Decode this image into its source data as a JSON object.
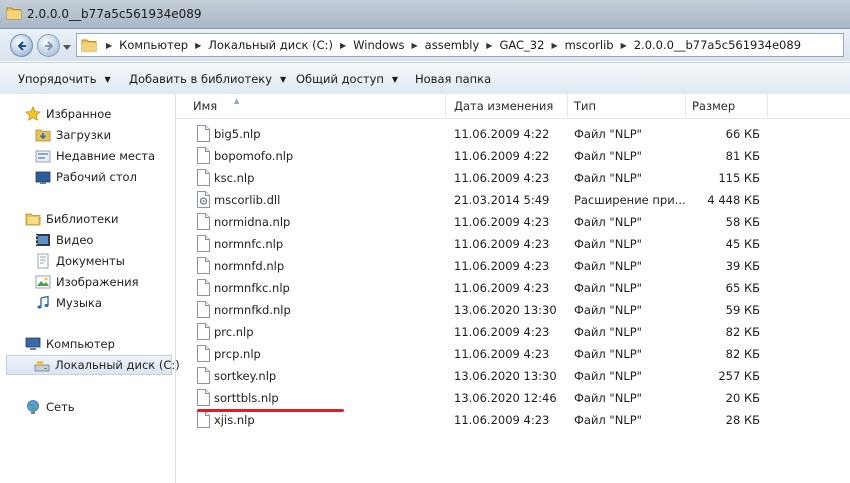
{
  "window": {
    "title": "2.0.0.0__b77a5c561934e089"
  },
  "address": {
    "crumbs": [
      "Компьютер",
      "Локальный диск (C:)",
      "Windows",
      "assembly",
      "GAC_32",
      "mscorlib",
      "2.0.0.0__b77a5c561934e089"
    ]
  },
  "toolbar": {
    "organize": "Упорядочить",
    "add_library": "Добавить в библиотеку",
    "share": "Общий доступ",
    "new_folder": "Новая папка"
  },
  "nav": {
    "favorites": "Избранное",
    "downloads": "Загрузки",
    "recent": "Недавние места",
    "desktop": "Рабочий стол",
    "libraries": "Библиотеки",
    "video": "Видео",
    "documents": "Документы",
    "images": "Изображения",
    "music": "Музыка",
    "computer": "Компьютер",
    "local_disk": "Локальный диск (C:)",
    "network": "Сеть"
  },
  "columns": {
    "name": "Имя",
    "date": "Дата изменения",
    "type": "Тип",
    "size": "Размер"
  },
  "files": [
    {
      "name": "big5.nlp",
      "date": "11.06.2009 4:22",
      "type": "Файл \"NLP\"",
      "size": "66 КБ",
      "icon": "file-icon"
    },
    {
      "name": "bopomofo.nlp",
      "date": "11.06.2009 4:22",
      "type": "Файл \"NLP\"",
      "size": "81 КБ",
      "icon": "file-icon"
    },
    {
      "name": "ksc.nlp",
      "date": "11.06.2009 4:23",
      "type": "Файл \"NLP\"",
      "size": "115 КБ",
      "icon": "file-icon"
    },
    {
      "name": "mscorlib.dll",
      "date": "21.03.2014 5:49",
      "type": "Расширение при...",
      "size": "4 448 КБ",
      "icon": "dll-icon"
    },
    {
      "name": "normidna.nlp",
      "date": "11.06.2009 4:23",
      "type": "Файл \"NLP\"",
      "size": "58 КБ",
      "icon": "file-icon"
    },
    {
      "name": "normnfc.nlp",
      "date": "11.06.2009 4:23",
      "type": "Файл \"NLP\"",
      "size": "45 КБ",
      "icon": "file-icon"
    },
    {
      "name": "normnfd.nlp",
      "date": "11.06.2009 4:23",
      "type": "Файл \"NLP\"",
      "size": "39 КБ",
      "icon": "file-icon"
    },
    {
      "name": "normnfkc.nlp",
      "date": "11.06.2009 4:23",
      "type": "Файл \"NLP\"",
      "size": "65 КБ",
      "icon": "file-icon"
    },
    {
      "name": "normnfkd.nlp",
      "date": "13.06.2020 13:30",
      "type": "Файл \"NLP\"",
      "size": "59 КБ",
      "icon": "file-icon"
    },
    {
      "name": "prc.nlp",
      "date": "11.06.2009 4:23",
      "type": "Файл \"NLP\"",
      "size": "82 КБ",
      "icon": "file-icon"
    },
    {
      "name": "prcp.nlp",
      "date": "11.06.2009 4:23",
      "type": "Файл \"NLP\"",
      "size": "82 КБ",
      "icon": "file-icon"
    },
    {
      "name": "sortkey.nlp",
      "date": "13.06.2020 13:30",
      "type": "Файл \"NLP\"",
      "size": "257 КБ",
      "icon": "file-icon"
    },
    {
      "name": "sorttbls.nlp",
      "date": "13.06.2020 12:46",
      "type": "Файл \"NLP\"",
      "size": "20 КБ",
      "icon": "file-icon"
    },
    {
      "name": "xjis.nlp",
      "date": "11.06.2009 4:23",
      "type": "Файл \"NLP\"",
      "size": "28 КБ",
      "icon": "file-icon"
    }
  ],
  "colors": {
    "annotation": "#e31b23",
    "selection": "#dce6f1"
  }
}
